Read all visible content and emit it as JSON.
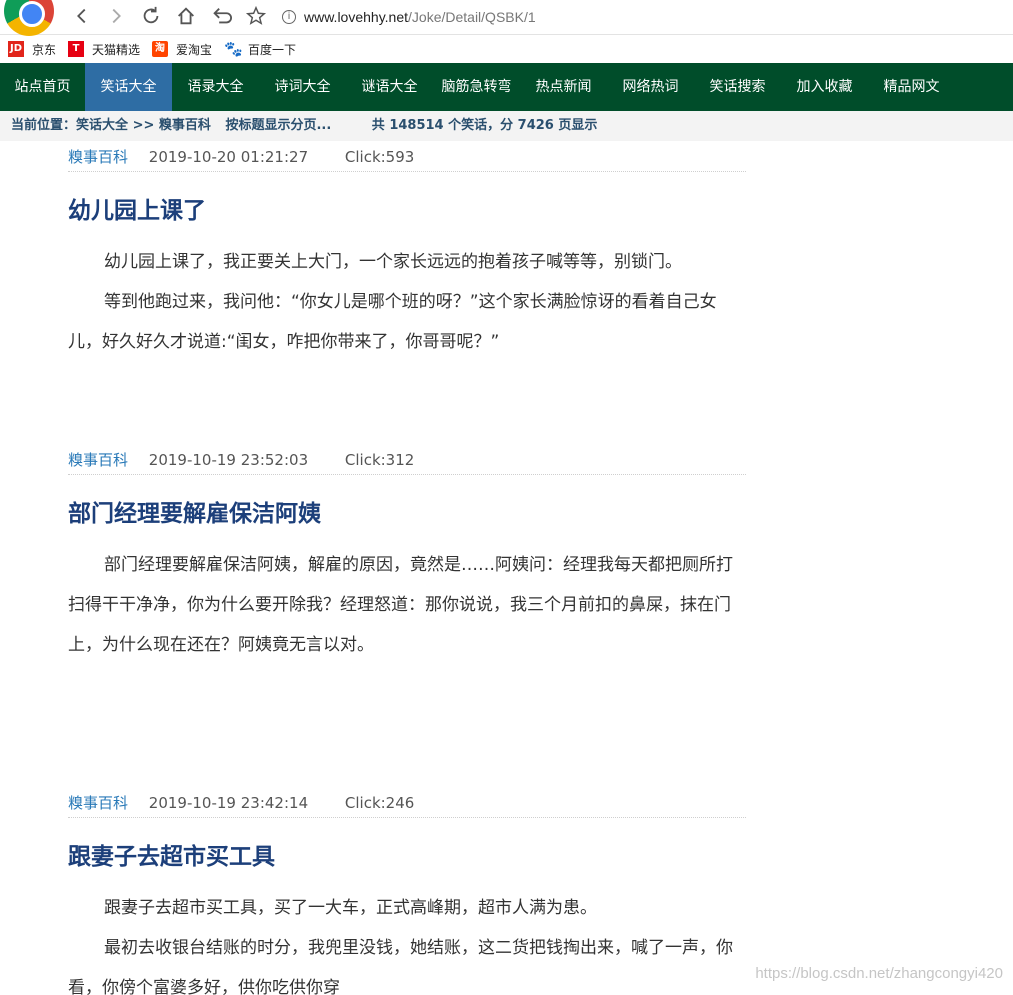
{
  "browser": {
    "url_host": "www.lovehhy.net",
    "url_path": "/Joke/Detail/QSBK/1"
  },
  "bookmarks": [
    {
      "label": "京东",
      "icon": "jd-icon"
    },
    {
      "label": "天猫精选",
      "icon": "tmall-icon"
    },
    {
      "label": "爱淘宝",
      "icon": "taobao-icon"
    },
    {
      "label": "百度一下",
      "icon": "baidu-paw-icon"
    }
  ],
  "site_nav": [
    "站点首页",
    "笑话大全",
    "语录大全",
    "诗词大全",
    "谜语大全",
    "脑筋急转弯",
    "热点新闻",
    "网络热词",
    "笑话搜索",
    "加入收藏",
    "精品网文"
  ],
  "site_nav_active_index": 1,
  "posbar": {
    "prefix": "当前位置：",
    "crumb1": "笑话大全",
    "sep": ">>",
    "crumb2": "糗事百科",
    "hint": "按标题显示分页...",
    "stats": "共 148514 个笑话，分 7426 页显示"
  },
  "articles": [
    {
      "category": "糗事百科",
      "datetime": "2019-10-20 01:21:27",
      "clicks": "Click:593",
      "title": "幼儿园上课了",
      "paragraphs": [
        "幼儿园上课了，我正要关上大门，一个家长远远的抱着孩子喊等等，别锁门。",
        "等到他跑过来，我问他：“你女儿是哪个班的呀？”这个家长满脸惊讶的看着自己女儿，好久好久才说道:“闺女，咋把你带来了，你哥哥呢？”"
      ]
    },
    {
      "category": "糗事百科",
      "datetime": "2019-10-19 23:52:03",
      "clicks": "Click:312",
      "title": "部门经理要解雇保洁阿姨",
      "paragraphs": [
        "部门经理要解雇保洁阿姨，解雇的原因，竟然是……阿姨问：经理我每天都把厕所打扫得干干净净，你为什么要开除我？经理怒道：那你说说，我三个月前扣的鼻屎，抹在门上，为什么现在还在？阿姨竟无言以对。"
      ]
    },
    {
      "category": "糗事百科",
      "datetime": "2019-10-19 23:42:14",
      "clicks": "Click:246",
      "title": "跟妻子去超市买工具",
      "paragraphs": [
        "跟妻子去超市买工具，买了一大车，正式高峰期，超市人满为患。",
        "最初去收银台结账的时分，我兜里没钱，她结账，这二货把钱掏出来，喊了一声，你看，你傍个富婆多好，供你吃供你穿"
      ]
    }
  ],
  "watermark": "https://blog.csdn.net/zhangcongyi420"
}
